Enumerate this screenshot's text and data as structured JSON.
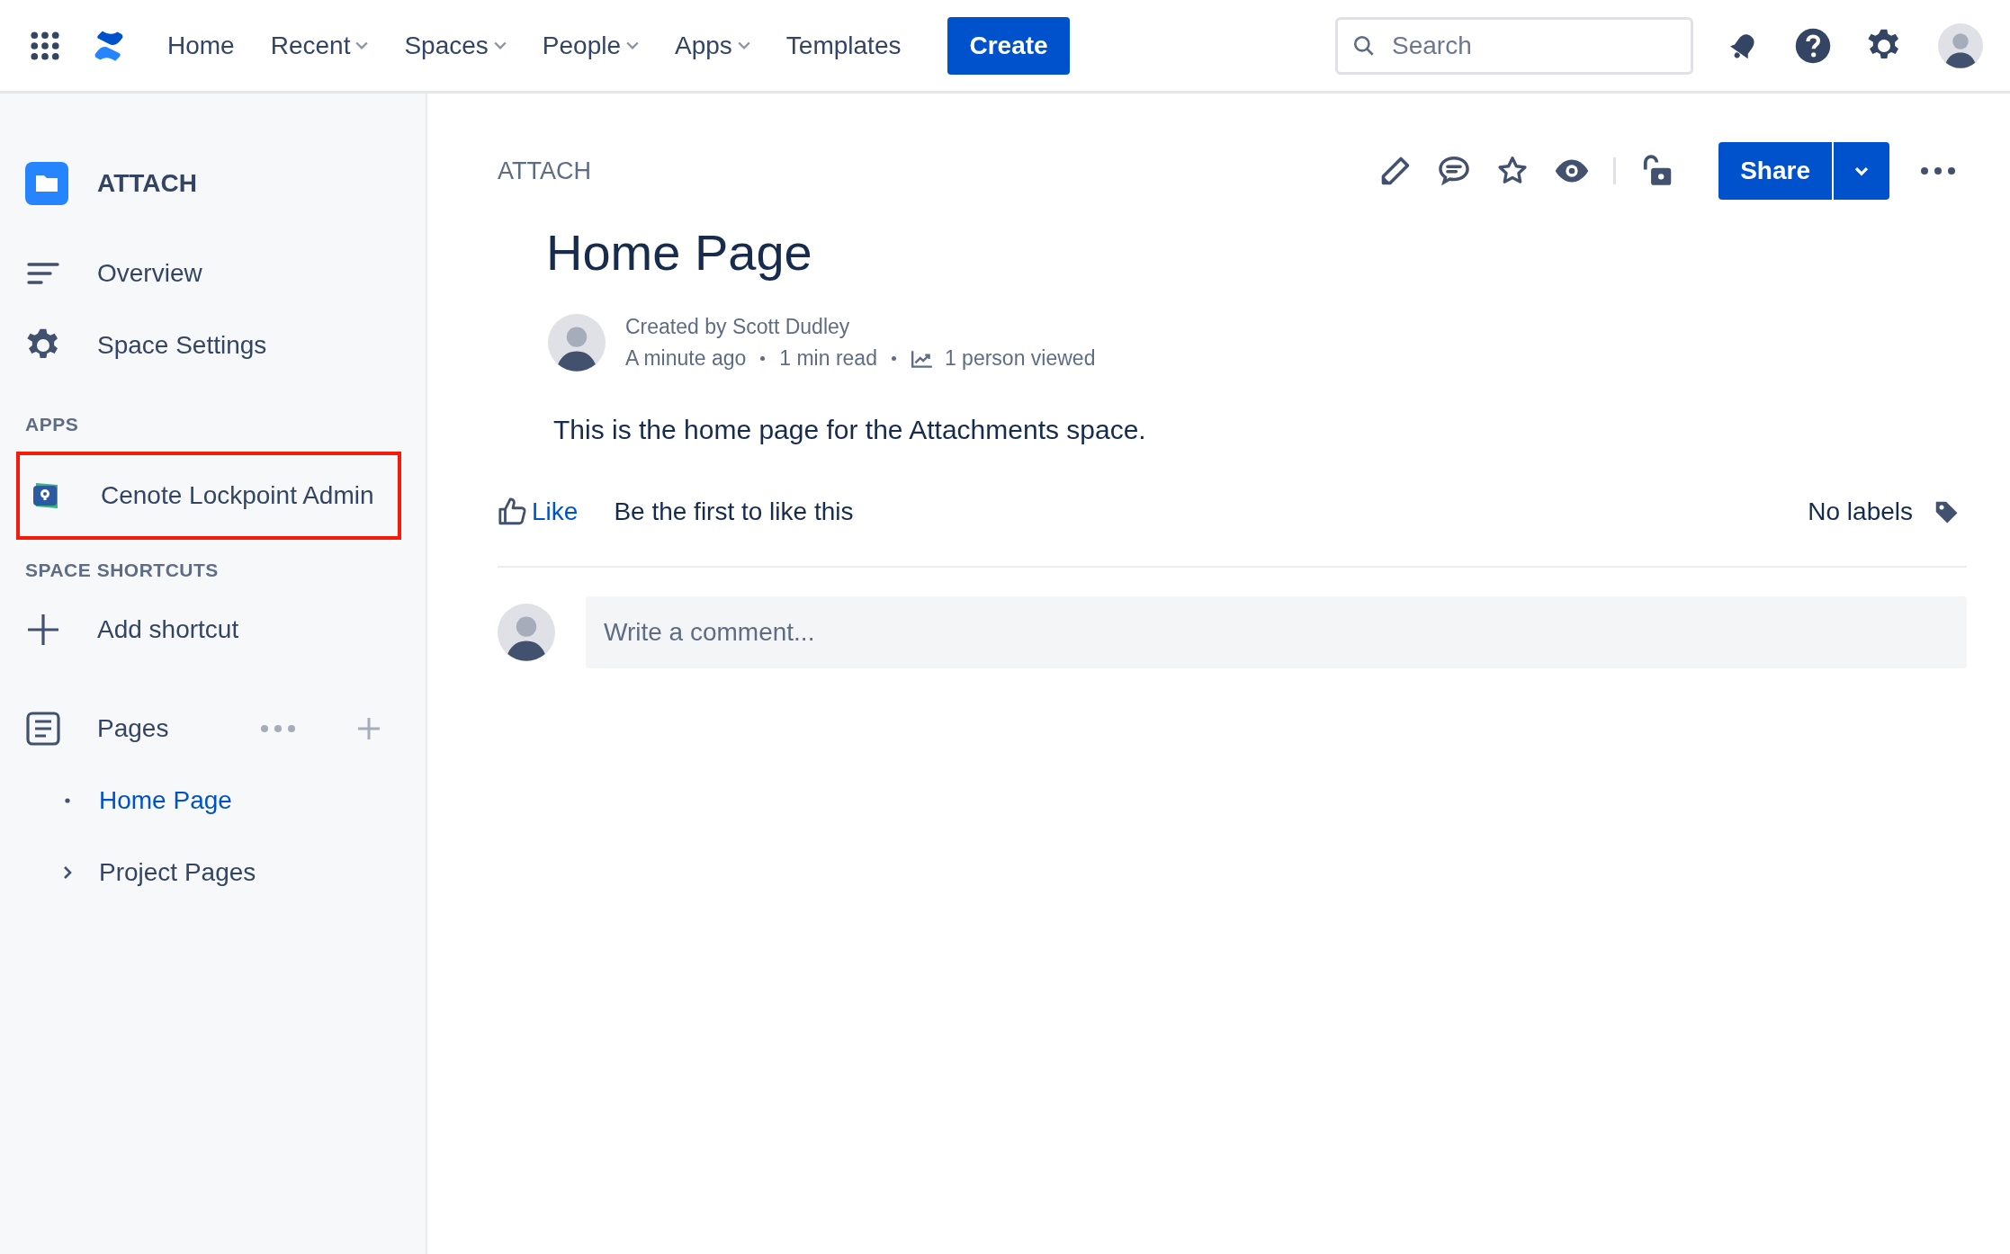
{
  "top_nav": {
    "items": [
      {
        "label": "Home",
        "dropdown": false
      },
      {
        "label": "Recent",
        "dropdown": true
      },
      {
        "label": "Spaces",
        "dropdown": true
      },
      {
        "label": "People",
        "dropdown": true
      },
      {
        "label": "Apps",
        "dropdown": true
      },
      {
        "label": "Templates",
        "dropdown": false
      }
    ],
    "create_button": "Create",
    "search": {
      "placeholder": "Search"
    }
  },
  "sidebar": {
    "space_name": "ATTACH",
    "items": [
      {
        "label": "Overview",
        "kind": "overview"
      },
      {
        "label": "Space Settings",
        "kind": "settings"
      }
    ],
    "apps_heading": "APPS",
    "apps": [
      {
        "label": "Cenote Lockpoint Admin",
        "highlighted": true
      }
    ],
    "shortcuts_heading": "SPACE SHORTCUTS",
    "add_shortcut": "Add shortcut",
    "pages_label": "Pages",
    "pages": [
      {
        "label": "Home Page",
        "selected": true,
        "expandable": false
      },
      {
        "label": "Project Pages",
        "selected": false,
        "expandable": true
      }
    ]
  },
  "page": {
    "breadcrumb": "ATTACH",
    "share_button": "Share",
    "title": "Home Page",
    "byline": "Created by Scott Dudley",
    "time": "A minute ago",
    "read_time": "1 min read",
    "views": "1 person viewed",
    "body": "This is the home page for the Attachments space.",
    "like": "Like",
    "like_hint": "Be the first to like this",
    "labels": "No labels",
    "comment": {
      "placeholder": "Write a comment..."
    }
  }
}
